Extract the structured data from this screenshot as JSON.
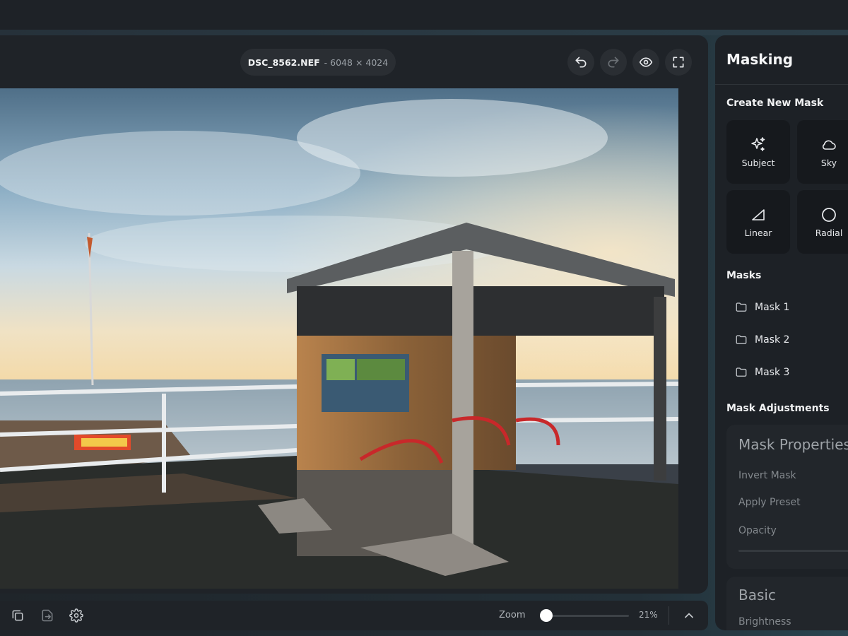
{
  "file": {
    "name": "DSC_8562.NEF",
    "dimensions": "- 6048 × 4024"
  },
  "toolbar": {
    "undo_icon": "undo-icon",
    "redo_icon": "redo-icon",
    "preview_icon": "eye-icon",
    "fullscreen_icon": "fullscreen-icon"
  },
  "bottombar": {
    "icons": [
      "copy-icon",
      "export-icon",
      "settings-icon"
    ],
    "zoom_label": "Zoom",
    "zoom_percent": "21%",
    "zoom_value": 0.0
  },
  "panel": {
    "title": "Masking",
    "create_heading": "Create New Mask",
    "mask_types": [
      {
        "label": "Subject",
        "icon": "sparkle-icon"
      },
      {
        "label": "Sky",
        "icon": "cloud-icon"
      },
      {
        "label": "Linear",
        "icon": "linear-gradient-icon"
      },
      {
        "label": "Radial",
        "icon": "circle-icon"
      }
    ],
    "masks_heading": "Masks",
    "masks": [
      {
        "label": "Mask 1",
        "icon": "folder-icon"
      },
      {
        "label": "Mask 2",
        "icon": "folder-icon"
      },
      {
        "label": "Mask 3",
        "icon": "folder-icon"
      }
    ],
    "adjustments_heading": "Mask Adjustments",
    "properties": {
      "title": "Mask Properties",
      "rows": [
        "Invert Mask",
        "Apply Preset",
        "Opacity"
      ]
    },
    "basic": {
      "title": "Basic",
      "rows": [
        "Brightness"
      ]
    }
  }
}
